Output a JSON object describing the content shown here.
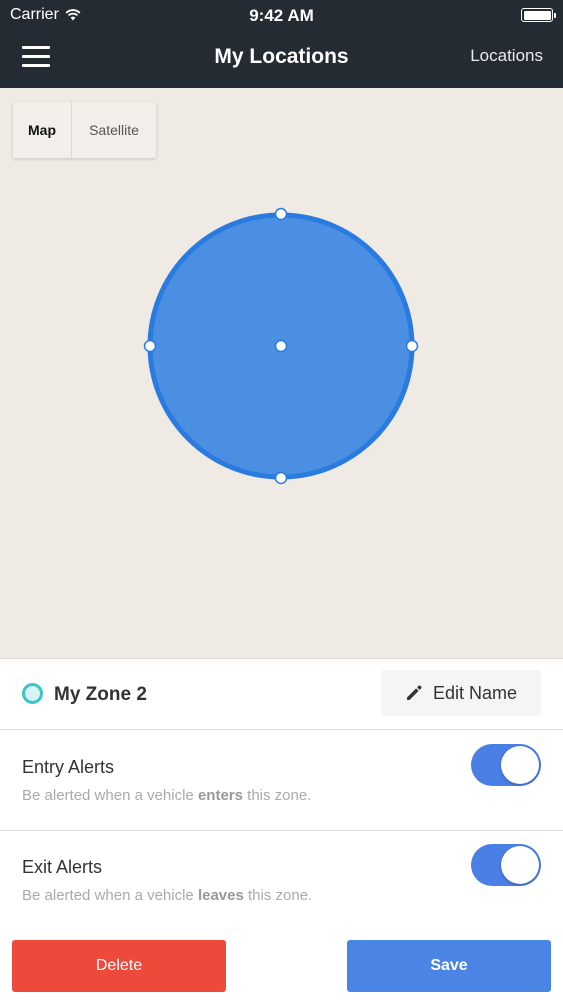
{
  "status_bar": {
    "carrier": "Carrier",
    "time": "9:42 AM"
  },
  "nav": {
    "title": "My Locations",
    "right_label": "Locations",
    "menu_icon": "hamburger-menu-icon"
  },
  "map": {
    "type_options": [
      "Map",
      "Satellite"
    ],
    "selected_type": "Map",
    "zone_fill_color": "#4a8fe2",
    "zone_stroke_color": "#2a7be0"
  },
  "zone": {
    "name": "My Zone 2",
    "edit_label": "Edit Name",
    "indicator_color": "#3cc4cc"
  },
  "entry_alerts": {
    "title": "Entry Alerts",
    "desc_before": "Be alerted when a vehicle ",
    "desc_bold": "enters",
    "desc_after": " this zone.",
    "enabled": true
  },
  "exit_alerts": {
    "title": "Exit Alerts",
    "desc_before": "Be alerted when a vehicle ",
    "desc_bold": "leaves",
    "desc_after": " this zone.",
    "enabled": true
  },
  "actions": {
    "delete_label": "Delete",
    "save_label": "Save"
  },
  "colors": {
    "nav_bg": "#252b33",
    "toggle_on": "#4a80e6",
    "delete": "#ee4a3b",
    "save": "#4a84e5"
  }
}
